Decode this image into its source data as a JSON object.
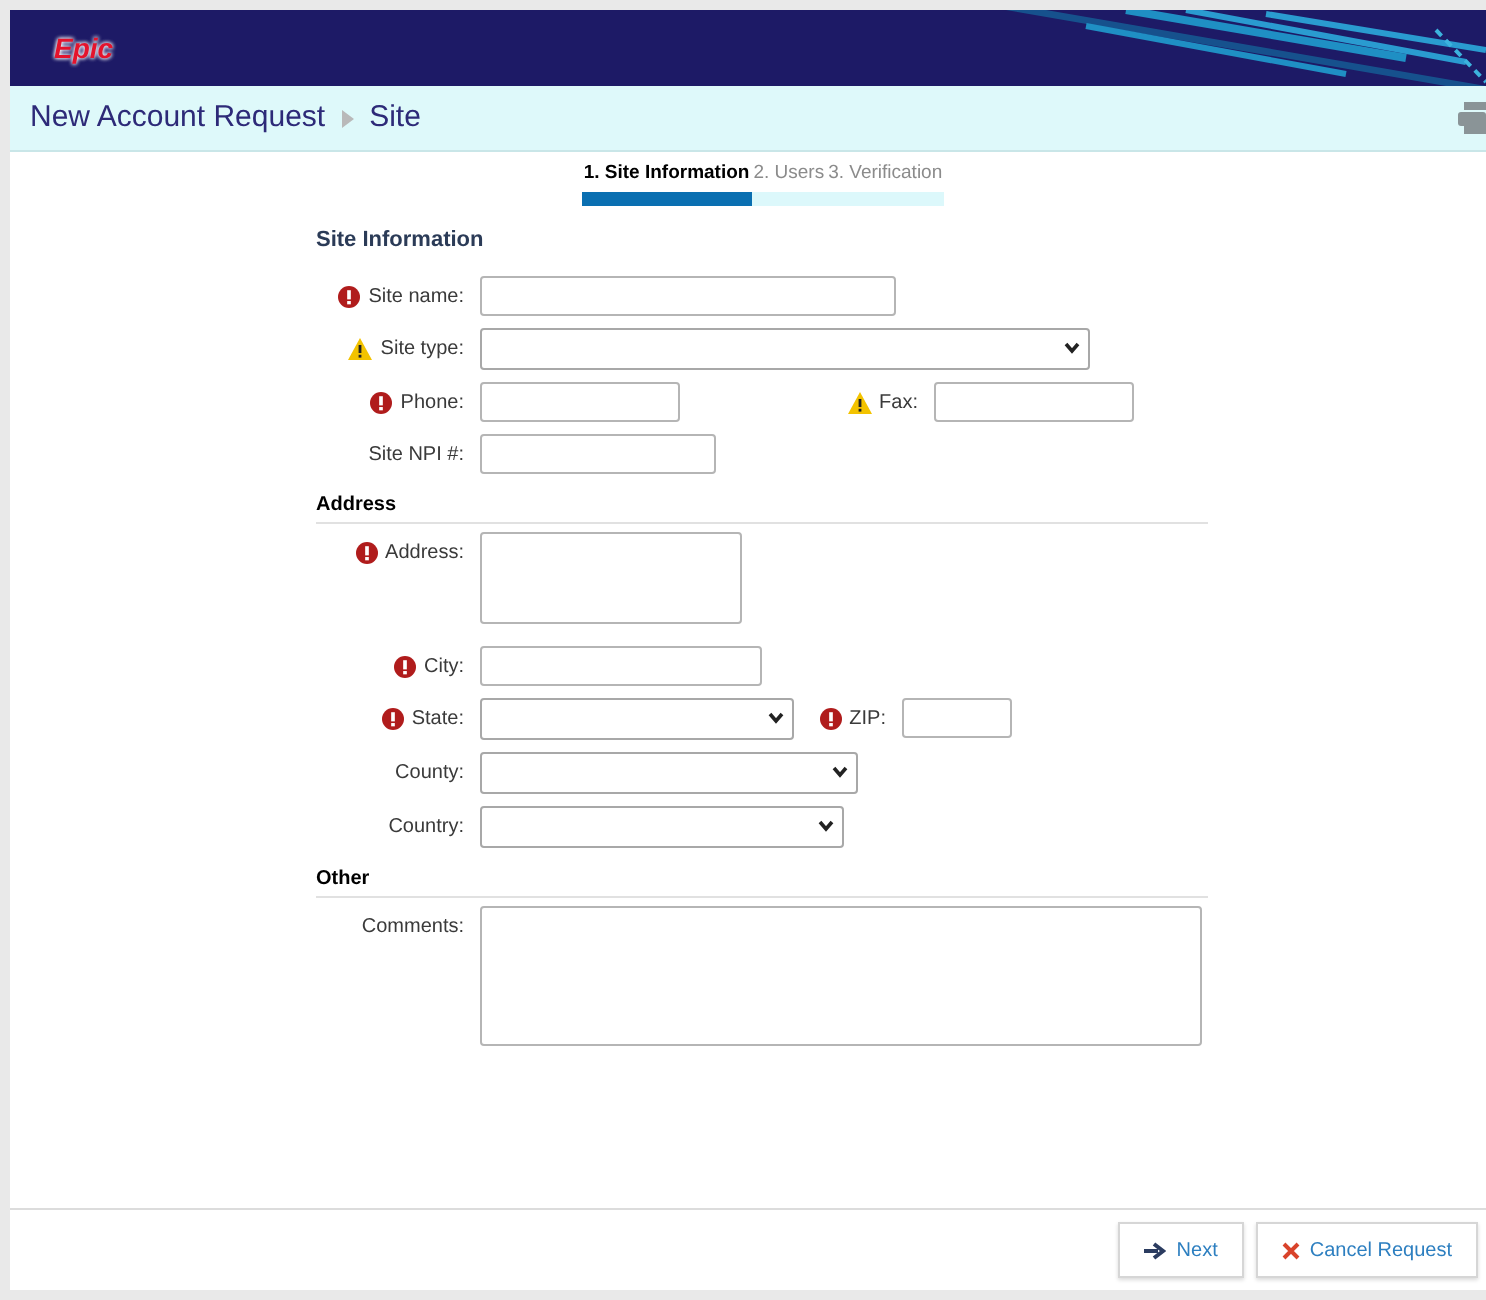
{
  "header": {
    "logo": "Epic"
  },
  "breadcrumb": {
    "items": [
      "New Account Request",
      "Site"
    ]
  },
  "steps": [
    {
      "label": "1. Site Information",
      "selected": true
    },
    {
      "label": "2. Users",
      "selected": false
    },
    {
      "label": "3. Verification",
      "selected": false
    }
  ],
  "sections": [
    {
      "title": "Site Information",
      "divider": false,
      "rows": [
        {
          "fields": [
            {
              "label": "Site name:",
              "required": true,
              "warning": false,
              "kind": "text"
            }
          ]
        },
        {
          "fields": [
            {
              "label": "Site type:",
              "required": false,
              "warning": true,
              "kind": "select"
            }
          ]
        },
        {
          "fields": [
            {
              "label": "Phone:",
              "required": true,
              "warning": false,
              "kind": "text"
            },
            {
              "label": "Fax:",
              "required": false,
              "warning": true,
              "kind": "text"
            }
          ]
        },
        {
          "fields": [
            {
              "label": "Site NPI #:",
              "required": false,
              "warning": false,
              "kind": "text"
            }
          ]
        }
      ]
    },
    {
      "title": "Address",
      "divider": true,
      "rows": [
        {
          "fields": [
            {
              "label": "Address:",
              "required": true,
              "warning": false,
              "kind": "textarea"
            }
          ]
        },
        {
          "fields": [
            {
              "label": "City:",
              "required": true,
              "warning": false,
              "kind": "text"
            }
          ]
        },
        {
          "fields": [
            {
              "label": "State:",
              "required": true,
              "warning": false,
              "kind": "select"
            },
            {
              "label": "ZIP:",
              "required": true,
              "warning": false,
              "kind": "text"
            }
          ]
        },
        {
          "fields": [
            {
              "label": "County:",
              "required": false,
              "warning": false,
              "kind": "select"
            }
          ]
        },
        {
          "fields": [
            {
              "label": "Country:",
              "required": false,
              "warning": false,
              "kind": "select"
            }
          ]
        }
      ]
    },
    {
      "title": "Other",
      "divider": true,
      "rows": [
        {
          "fields": [
            {
              "label": "Comments:",
              "required": false,
              "warning": false,
              "kind": "textarea"
            }
          ]
        }
      ]
    }
  ],
  "buttons": [
    {
      "label": "Next",
      "kind": "next"
    },
    {
      "label": "Cancel Request",
      "kind": "cancel"
    }
  ]
}
